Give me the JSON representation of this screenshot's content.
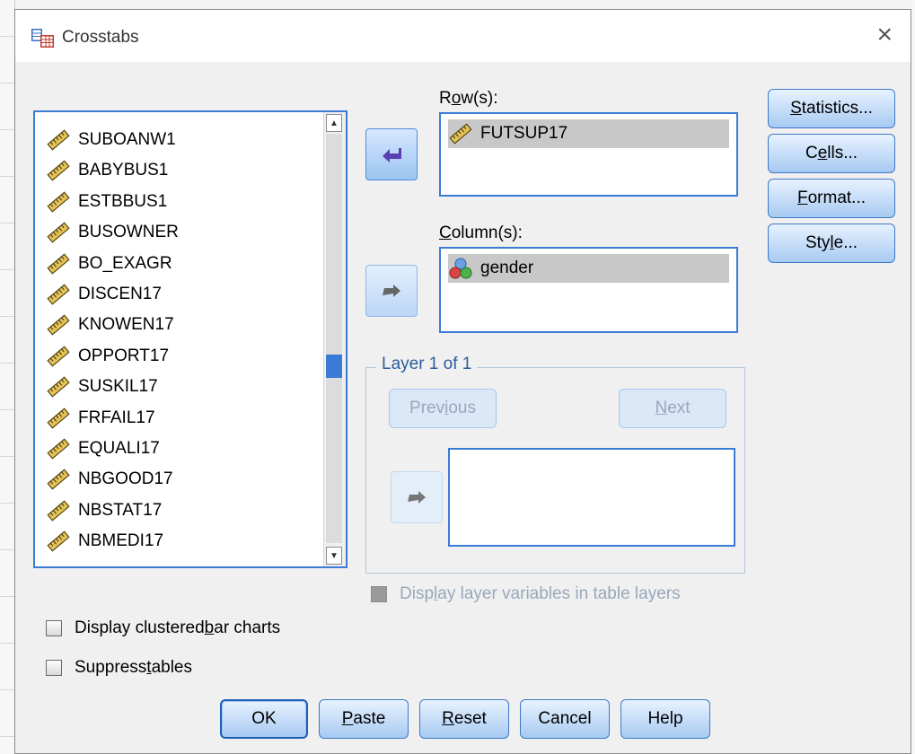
{
  "dialog": {
    "title": "Crosstabs",
    "close_label": "×"
  },
  "variables": {
    "items": [
      "SUBOANW1",
      "BABYBUS1",
      "ESTBBUS1",
      "BUSOWNER",
      "BO_EXAGR",
      "DISCEN17",
      "KNOWEN17",
      "OPPORT17",
      "SUSKIL17",
      "FRFAIL17",
      "EQUALI17",
      "NBGOOD17",
      "NBSTAT17",
      "NBMEDI17"
    ],
    "icon": "scale-ruler-icon"
  },
  "rows": {
    "label_u": "o",
    "label_pre": "R",
    "label_post": "w(s):",
    "items": [
      "FUTSUP17"
    ],
    "icon": "scale-ruler-icon"
  },
  "columns": {
    "label_u": "C",
    "label_pre": "",
    "label_post": "olumn(s):",
    "items": [
      "gender"
    ],
    "icon": "nominal-icon"
  },
  "layer": {
    "title": "Layer 1 of 1",
    "previous_pre": "Prev",
    "previous_u": "i",
    "previous_post": "ous",
    "next_u": "N",
    "next_post": "ext"
  },
  "side_buttons": [
    {
      "pre": "",
      "u": "S",
      "post": "tatistics..."
    },
    {
      "pre": "C",
      "u": "e",
      "post": "lls..."
    },
    {
      "pre": "",
      "u": "F",
      "post": "ormat..."
    },
    {
      "pre": "Sty",
      "u": "l",
      "post": "e..."
    }
  ],
  "display_layer_vars": {
    "pre": "Disp",
    "u": "l",
    "post": "ay layer variables in table layers",
    "checked": false,
    "enabled": false
  },
  "clustered_bar": {
    "pre": "Display clustered ",
    "u": "b",
    "post": "ar charts",
    "checked": false
  },
  "suppress_tables": {
    "pre": "Suppress ",
    "u": "t",
    "post": "ables",
    "checked": false
  },
  "footer": {
    "ok": "OK",
    "paste_u": "P",
    "paste_post": "aste",
    "reset_u": "R",
    "reset_post": "eset",
    "cancel": "Cancel",
    "help": "Help"
  },
  "colors": {
    "accent": "#3b7bd6",
    "button_top": "#e8f2ff",
    "button_bottom": "#a7caf2",
    "disabled_text": "#98a8bb"
  }
}
